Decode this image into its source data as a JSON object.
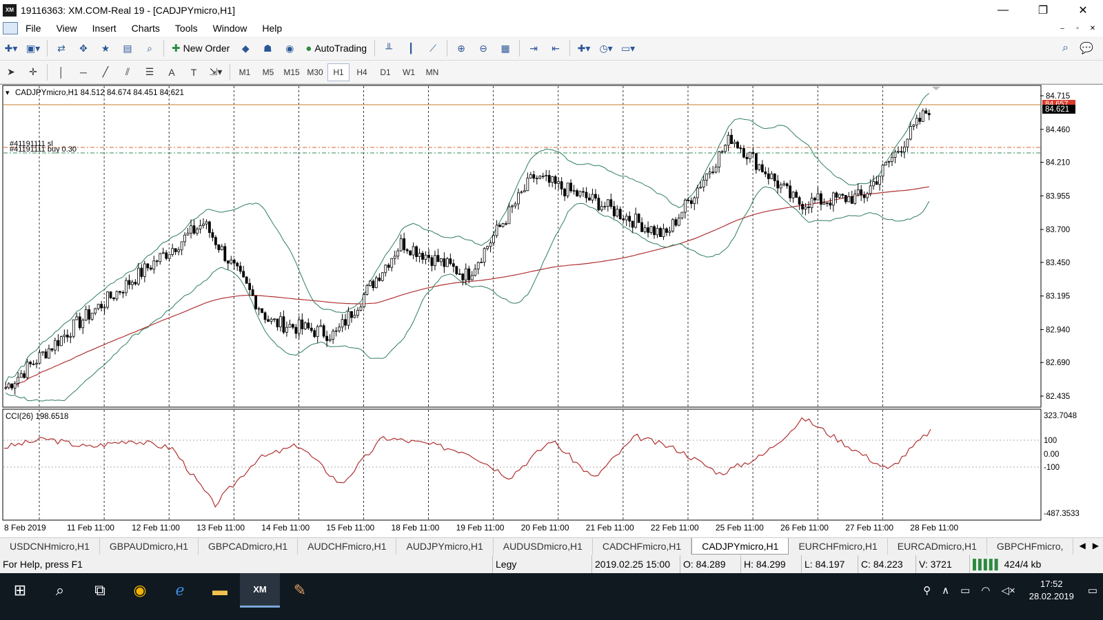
{
  "window": {
    "title": "19116363: XM.COM-Real 19 - [CADJPYmicro,H1]",
    "logo": "XM",
    "controls": {
      "minimize": "—",
      "maximize": "❐",
      "close": "✕"
    }
  },
  "menu": {
    "items": [
      "File",
      "View",
      "Insert",
      "Charts",
      "Tools",
      "Window",
      "Help"
    ],
    "mdi": {
      "minimize": "–",
      "restore": "▫",
      "close": "✕"
    }
  },
  "toolbar": {
    "new_order": "New Order",
    "autotrading": "AutoTrading"
  },
  "timeframes": {
    "items": [
      "M1",
      "M5",
      "M15",
      "M30",
      "H1",
      "H4",
      "D1",
      "W1",
      "MN"
    ],
    "active": "H1"
  },
  "chart": {
    "header": "CADJPYmicro,H1  84.512 84.674 84.451 84.621",
    "symbol": "CADJPYmicro",
    "timeframe": "H1",
    "ohlc": {
      "open": 84.512,
      "high": 84.674,
      "low": 84.451,
      "close": 84.621
    },
    "order_sl_label": "#41191111 sl",
    "order_buy_label": "#41191111 buy 0.30",
    "current_price_label": "84.621",
    "ask_label": "84.657",
    "price_ticks": [
      "84.715",
      "84.460",
      "84.210",
      "83.955",
      "83.700",
      "83.450",
      "83.195",
      "82.940",
      "82.690",
      "82.435"
    ],
    "cci_header": "CCI(26) 198.6518",
    "cci_ticks": [
      "323.7048",
      "100",
      "0.00",
      "-100",
      "-487.3533"
    ],
    "time_ticks": [
      "8 Feb 2019",
      "11 Feb 11:00",
      "12 Feb 11:00",
      "13 Feb 11:00",
      "14 Feb 11:00",
      "15 Feb 11:00",
      "18 Feb 11:00",
      "19 Feb 11:00",
      "20 Feb 11:00",
      "21 Feb 11:00",
      "22 Feb 11:00",
      "25 Feb 11:00",
      "26 Feb 11:00",
      "27 Feb 11:00",
      "28 Feb 11:00"
    ],
    "colors": {
      "candle": "#000000",
      "bands": "#2e7d5b",
      "ma": "#b03030",
      "cci": "#b03030",
      "sl_line": "#d9622b",
      "buy_line": "#2e8b57",
      "bid_line": "#c77d2a",
      "price_box": "#000000",
      "ask_box": "#d93a2b"
    }
  },
  "chart_data": {
    "type": "line",
    "title": "CADJPYmicro,H1",
    "x": [
      "8 Feb 2019",
      "11 Feb 11:00",
      "12 Feb 11:00",
      "13 Feb 11:00",
      "14 Feb 11:00",
      "15 Feb 11:00",
      "18 Feb 11:00",
      "19 Feb 11:00",
      "20 Feb 11:00",
      "21 Feb 11:00",
      "22 Feb 11:00",
      "25 Feb 11:00",
      "26 Feb 11:00",
      "27 Feb 11:00",
      "28 Feb 11:00"
    ],
    "ylim": [
      82.435,
      84.715
    ],
    "series": [
      {
        "name": "CADJPYmicro,H1",
        "values": [
          82.5,
          82.95,
          83.35,
          83.75,
          83.0,
          82.9,
          83.6,
          83.35,
          84.1,
          83.9,
          83.65,
          84.4,
          83.9,
          83.95,
          84.62
        ]
      }
    ],
    "cci": {
      "name": "CCI(26)",
      "ylim": [
        -487.3533,
        323.7048
      ],
      "values": [
        60,
        130,
        60,
        120,
        50,
        -420,
        -40,
        80,
        -250,
        140,
        90,
        20,
        -190,
        120,
        -200,
        150,
        40,
        -160,
        -10,
        300,
        80,
        -130,
        200
      ]
    }
  },
  "tabs": {
    "items": [
      "USDCNHmicro,H1",
      "GBPAUDmicro,H1",
      "GBPCADmicro,H1",
      "AUDCHFmicro,H1",
      "AUDJPYmicro,H1",
      "AUDUSDmicro,H1",
      "CADCHFmicro,H1",
      "CADJPYmicro,H1",
      "EURCHFmicro,H1",
      "EURCADmicro,H1",
      "GBPCHFmicro,"
    ],
    "active": "CADJPYmicro,H1"
  },
  "status": {
    "help": "For Help, press F1",
    "profile": "Legy",
    "datetime": "2019.02.25 15:00",
    "open": "O: 84.289",
    "high": "H: 84.299",
    "low": "L: 84.197",
    "close": "C: 84.223",
    "volume": "V: 3721",
    "traffic": "424/4 kb"
  },
  "taskbar": {
    "time": "17:52",
    "date": "28.02.2019"
  }
}
